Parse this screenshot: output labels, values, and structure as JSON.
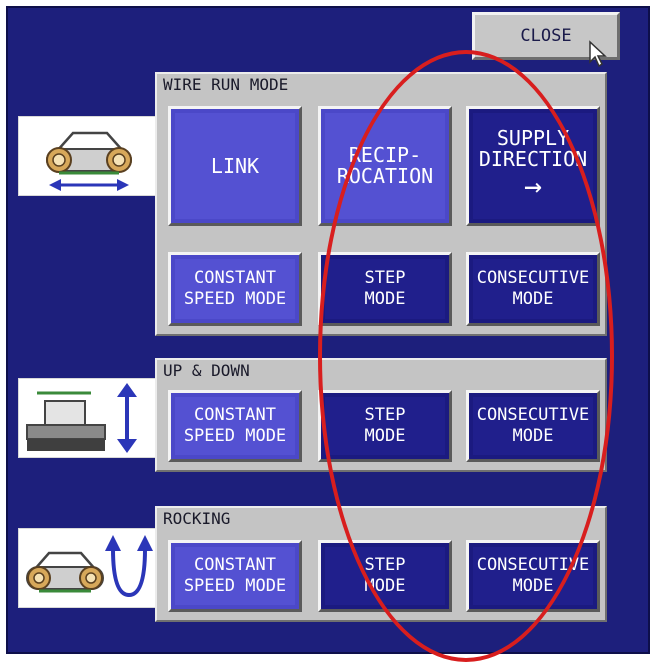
{
  "close_label": "CLOSE",
  "wire_run": {
    "title": "WIRE RUN MODE",
    "link": "LINK",
    "recip": [
      "RECIP-",
      "ROCATION"
    ],
    "supply": [
      "SUPPLY",
      "DIRECTION",
      "→"
    ],
    "constant": [
      "CONSTANT",
      "SPEED MODE"
    ],
    "step": [
      "STEP",
      "MODE"
    ],
    "consecutive": [
      "CONSECUTIVE",
      "MODE"
    ]
  },
  "up_down": {
    "title": "UP & DOWN",
    "constant": [
      "CONSTANT",
      "SPEED MODE"
    ],
    "step": [
      "STEP",
      "MODE"
    ],
    "consecutive": [
      "CONSECUTIVE",
      "MODE"
    ]
  },
  "rocking": {
    "title": "ROCKING",
    "constant": [
      "CONSTANT",
      "SPEED MODE"
    ],
    "step": [
      "STEP",
      "MODE"
    ],
    "consecutive": [
      "CONSECUTIVE",
      "MODE"
    ]
  },
  "icons": {
    "wire_run": "crawler-horizontal-arrow-icon",
    "up_down": "press-vertical-arrow-icon",
    "rocking": "crawler-rocking-arrow-icon"
  },
  "colors": {
    "screen_bg": "#1d1f7c",
    "panel_bg": "#c4c4c4",
    "button_light": "#5451d2",
    "button_dark": "#201f8c",
    "highlight_ellipse": "#d81e1e"
  }
}
